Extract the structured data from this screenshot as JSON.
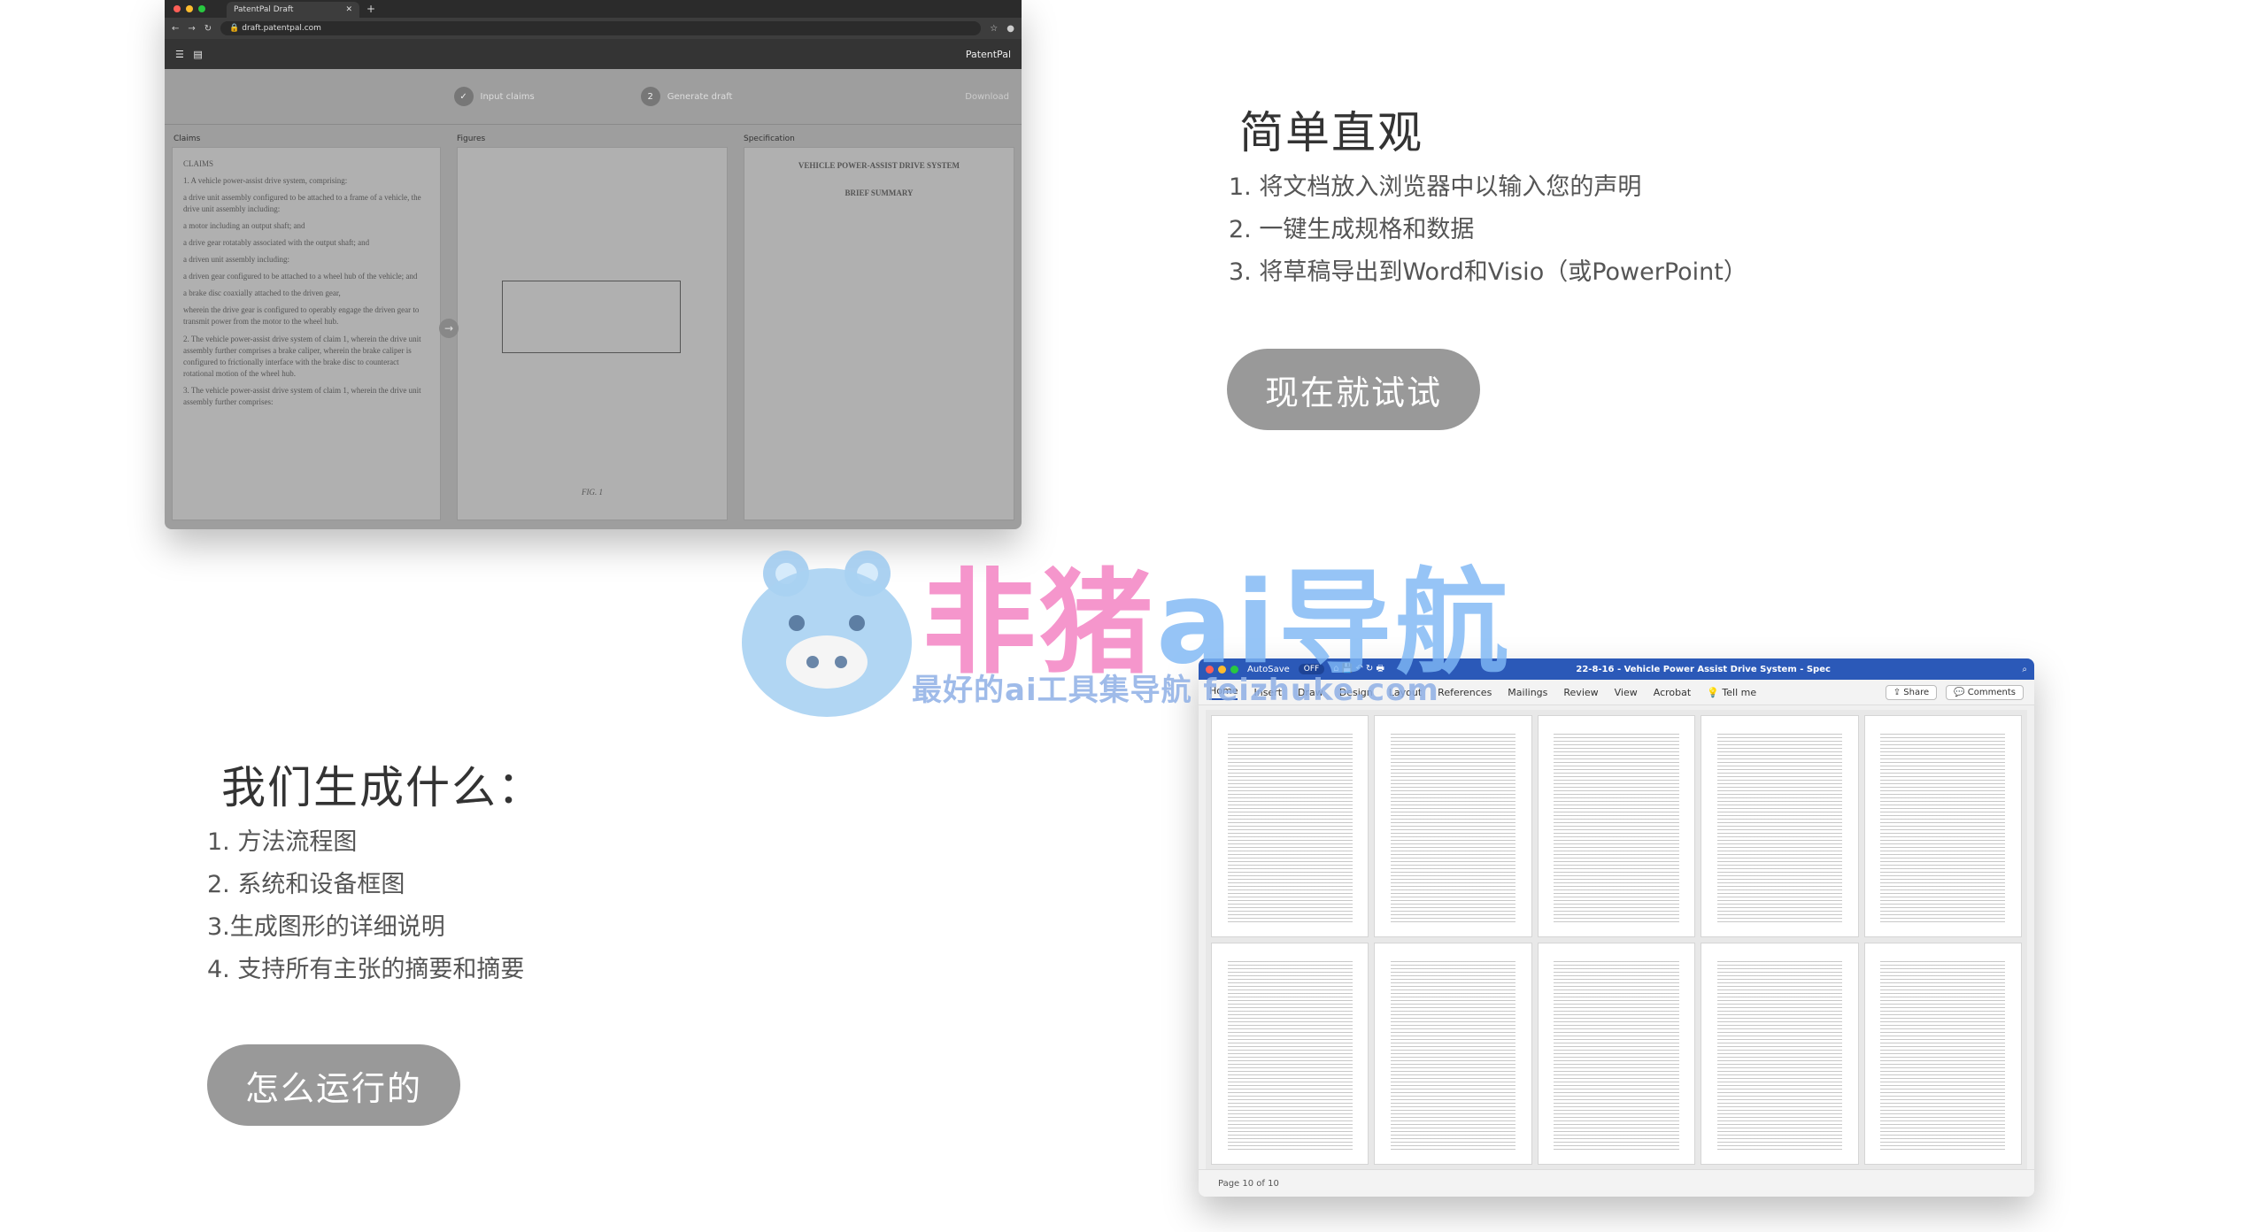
{
  "browser": {
    "tab_title": "PatentPal Draft",
    "url": "draft.patentpal.com",
    "app_name": "PatentPal",
    "steps": [
      "Input claims",
      "Generate draft"
    ],
    "download_label": "Download",
    "panels": {
      "claims_label": "Claims",
      "figures_label": "Figures",
      "spec_label": "Specification",
      "claims_heading": "CLAIMS",
      "claims_lines": [
        "1.    A vehicle power-assist drive system, comprising:",
        "a drive unit assembly configured to be attached to a frame of a vehicle, the drive unit assembly including:",
        "a motor including an output shaft; and",
        "a drive gear rotatably associated with the output shaft; and",
        "a driven unit assembly including:",
        "a driven gear configured to be attached to a wheel hub of the vehicle; and",
        "a brake disc coaxially attached to the driven gear,",
        "wherein the drive gear is configured to operably engage the driven gear to transmit power from the motor to the wheel hub.",
        "2.    The vehicle power-assist drive system of claim 1, wherein the drive unit assembly further comprises a brake caliper, wherein the brake caliper is configured to frictionally interface with the brake disc to counteract rotational motion of the wheel hub.",
        "3. The vehicle power-assist drive system of claim 1, wherein the drive unit assembly further comprises:"
      ],
      "figure_label": "FIG. 1",
      "spec_title": "VEHICLE POWER-ASSIST DRIVE SYSTEM",
      "spec_subtitle": "BRIEF SUMMARY"
    }
  },
  "section1": {
    "heading": "简单直观",
    "items": [
      "1. 将文档放入浏览器中以输入您的声明",
      "2. 一键生成规格和数据",
      "3. 将草稿导出到Word和Visio（或PowerPoint）"
    ],
    "cta_label": "现在就试试"
  },
  "section2": {
    "heading": "我们生成什么：",
    "items": [
      "1. 方法流程图",
      "2. 系统和设备框图",
      "3.生成图形的详细说明",
      "4. 支持所有主张的摘要和摘要"
    ],
    "cta_label": "怎么运行的"
  },
  "word": {
    "autosave_label": "AutoSave",
    "autosave_state": "OFF",
    "doc_title": "22-8-16 - Vehicle Power Assist Drive System - Spec",
    "ribbon_tabs": [
      "Home",
      "Insert",
      "Draw",
      "Design",
      "Layout",
      "References",
      "Mailings",
      "Review",
      "View",
      "Acrobat",
      "Tell me"
    ],
    "share_label": "Share",
    "comments_label": "Comments",
    "status_text": "Page 10 of 10",
    "page_count": 10
  },
  "watermark": {
    "title_part1": "非猪",
    "title_part2": "ai",
    "title_part3": "导航",
    "subtitle": "最好的ai工具集导航 feizhuke.com"
  },
  "colors": {
    "cta_bg": "#999999",
    "heading": "#333333",
    "body_text": "#555555",
    "word_blue": "#2b59b8",
    "watermark_pink": "#f47fc2",
    "watermark_blue": "#7fb8f5"
  }
}
